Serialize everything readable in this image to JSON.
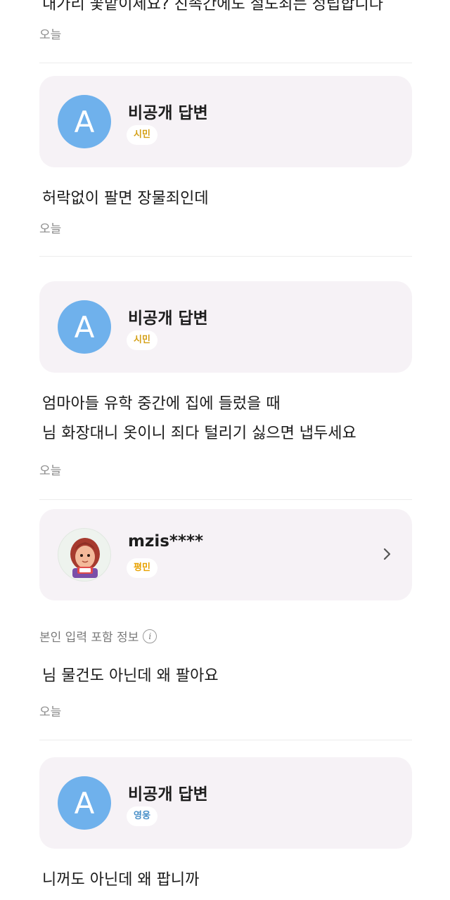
{
  "partial_top": {
    "text": "내가리 꽃밭이세요? 친족간에도 절도죄는 성립합니다",
    "date": "오늘"
  },
  "answers": [
    {
      "name": "비공개 답변",
      "avatar_letter": "A",
      "badge": "시민",
      "badge_color": "#d4a017",
      "lines": [
        "허락없이 팔면 장물죄인데"
      ],
      "date": "오늘"
    },
    {
      "name": "비공개 답변",
      "avatar_letter": "A",
      "badge": "시민",
      "badge_color": "#d4a017",
      "lines": [
        "엄마아들 유학 중간에 집에 들렀을 때",
        "님 화장대니 옷이니 죄다 털리기 싫으면 냅두세요"
      ],
      "date": "오늘"
    },
    {
      "name": "mzis****",
      "avatar_icon": "character-avatar-icon",
      "badge": "평민",
      "badge_color": "#e8a200",
      "info_label": "본인 입력 포함 정보",
      "lines": [
        "님 물건도 아닌데 왜 팔아요"
      ],
      "date": "오늘"
    },
    {
      "name": "비공개 답변",
      "avatar_letter": "A",
      "badge": "영웅",
      "badge_color": "#4a90c8",
      "lines": [
        "니꺼도 아닌데 왜 팝니까"
      ]
    }
  ],
  "colors": {
    "card_bg": "#f6f2f6",
    "avatar_blue": "#6fb1ec",
    "date_gray": "#8a8a8a"
  }
}
